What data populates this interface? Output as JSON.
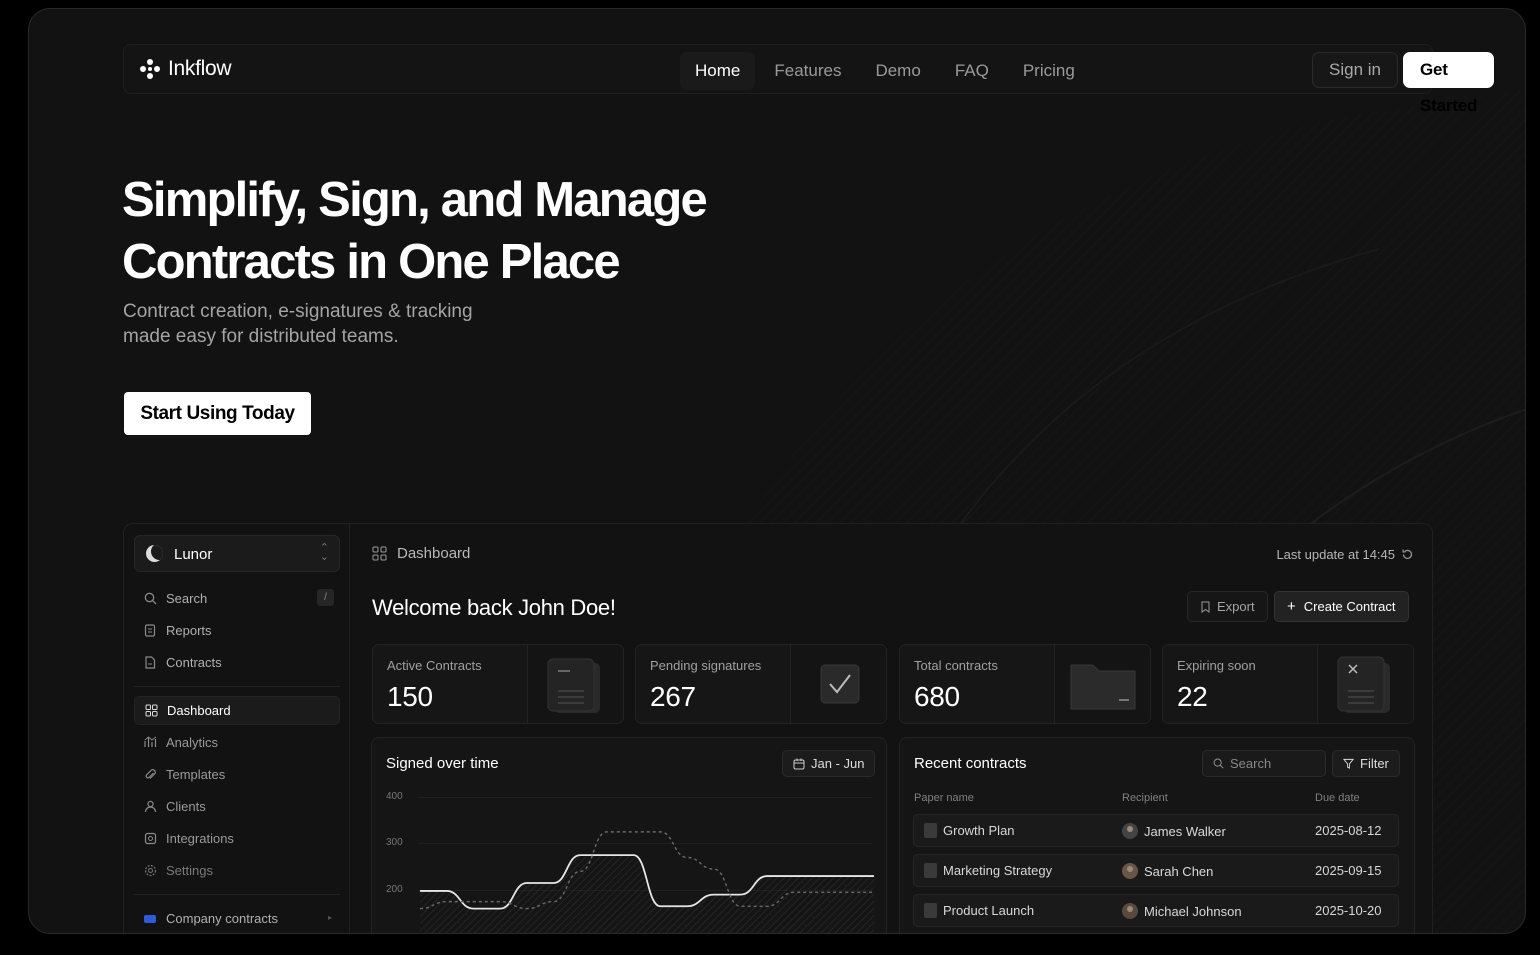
{
  "brand": {
    "name": "Inkflow"
  },
  "nav": {
    "links": [
      "Home",
      "Features",
      "Demo",
      "FAQ",
      "Pricing"
    ],
    "active": "Home",
    "signin": "Sign in",
    "get_started": "Get Started"
  },
  "hero": {
    "title_line1": "Simplify, Sign, and Manage",
    "title_line2": "Contracts in One Place",
    "subtitle_line1": "Contract creation, e-signatures & tracking",
    "subtitle_line2": "made easy for distributed teams.",
    "cta": "Start Using Today"
  },
  "dashboard": {
    "workspace": "Lunor",
    "sidebar_top": [
      {
        "label": "Search",
        "icon": "search-icon",
        "shortcut": "/"
      },
      {
        "label": "Reports",
        "icon": "reports-icon"
      },
      {
        "label": "Contracts",
        "icon": "contracts-icon"
      }
    ],
    "sidebar_main": [
      {
        "label": "Dashboard",
        "icon": "grid-icon",
        "active": true
      },
      {
        "label": "Analytics",
        "icon": "analytics-icon"
      },
      {
        "label": "Templates",
        "icon": "paperclip-icon"
      },
      {
        "label": "Clients",
        "icon": "user-icon"
      },
      {
        "label": "Integrations",
        "icon": "integrations-icon"
      },
      {
        "label": "Settings",
        "icon": "gear-icon"
      }
    ],
    "sidebar_bottom": {
      "label": "Company contracts",
      "icon": "folder-icon",
      "color": "#2f5ad8"
    },
    "breadcrumb": "Dashboard",
    "last_update": "Last update at 14:45",
    "welcome": "Welcome back John Doe!",
    "export": "Export",
    "create": "Create Contract",
    "stats": [
      {
        "label": "Active Contracts",
        "value": "150",
        "illustration": "document-icon"
      },
      {
        "label": "Pending signatures",
        "value": "267",
        "illustration": "check-icon"
      },
      {
        "label": "Total contracts",
        "value": "680",
        "illustration": "folder-icon"
      },
      {
        "label": "Expiring soon",
        "value": "22",
        "illustration": "x-document-icon"
      }
    ],
    "chart_card": {
      "title": "Signed over time",
      "range": "Jan - Jun"
    },
    "recent": {
      "title": "Recent contracts",
      "search_placeholder": "Search",
      "filter": "Filter",
      "columns": [
        "Paper name",
        "Recipient",
        "Due date"
      ],
      "rows": [
        {
          "name": "Growth Plan",
          "recipient": "James Walker",
          "due": "2025-08-12"
        },
        {
          "name": "Marketing Strategy",
          "recipient": "Sarah Chen",
          "due": "2025-09-15"
        },
        {
          "name": "Product Launch",
          "recipient": "Michael Johnson",
          "due": "2025-10-20"
        }
      ]
    }
  },
  "chart_data": {
    "type": "line",
    "title": "Signed over time",
    "ylim": [
      100,
      400
    ],
    "yticks": [
      "400",
      "300",
      "200"
    ],
    "x": [
      0,
      1,
      2,
      3,
      4,
      5,
      6,
      7,
      8,
      9,
      10,
      11,
      12,
      13,
      14,
      15,
      16,
      17
    ],
    "series": [
      {
        "style": "solid",
        "values": [
          198,
          198,
          160,
          160,
          215,
          215,
          275,
          275,
          275,
          165,
          165,
          190,
          190,
          230,
          230,
          230,
          230,
          230
        ]
      },
      {
        "style": "dashed",
        "values": [
          160,
          175,
          175,
          175,
          160,
          175,
          240,
          325,
          325,
          325,
          270,
          245,
          165,
          165,
          195,
          195,
          195,
          195
        ]
      }
    ]
  }
}
